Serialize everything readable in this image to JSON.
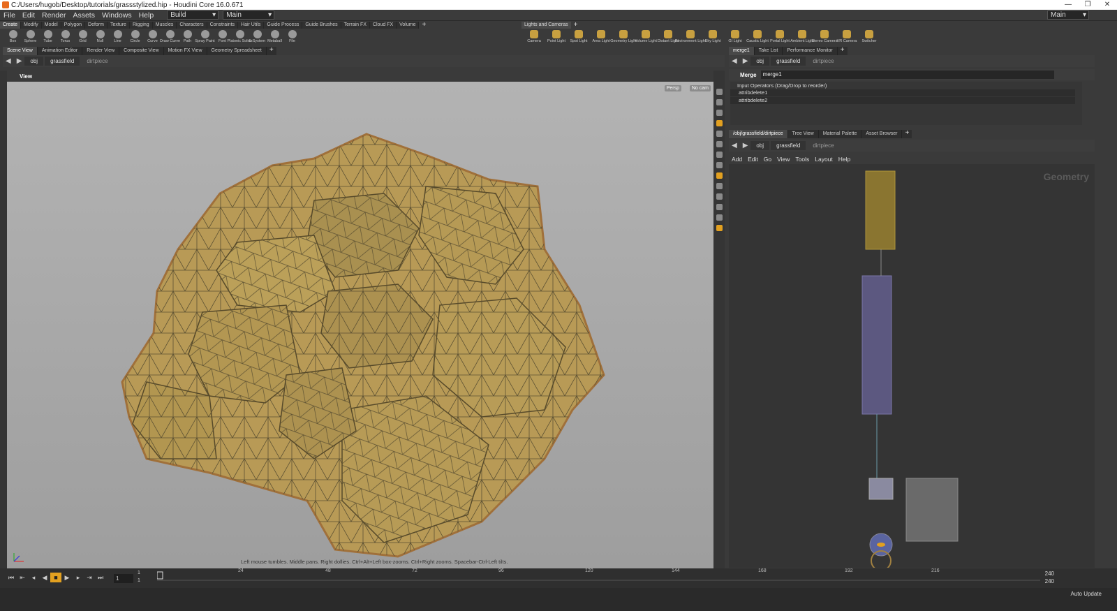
{
  "window": {
    "title": "C:/Users/hugob/Desktop/tutorials/grassstylized.hip - Houdini Core 16.0.671"
  },
  "menu": {
    "items": [
      "File",
      "Edit",
      "Render",
      "Assets",
      "Windows",
      "Help"
    ],
    "desktop": "Build",
    "desktop2": "Main",
    "right_desktop": "Main"
  },
  "shelf_tabs": [
    "Create",
    "Modify",
    "Model",
    "Polygon",
    "Deform",
    "Texture",
    "Rigging",
    "Muscles",
    "Characters",
    "Constraints",
    "Hair Utils",
    "Guide Process",
    "Guide Brushes",
    "Terrain FX",
    "Cloud FX",
    "Volume"
  ],
  "shelf_tools": [
    "Box",
    "Sphere",
    "Tube",
    "Torus",
    "Grid",
    "Null",
    "Line",
    "Circle",
    "Curve",
    "Draw Curve",
    "Path",
    "Spray Paint",
    "Font",
    "Platonic Solids",
    "L-System",
    "Metaball",
    "File"
  ],
  "shelf2_tab": "Lights and Cameras",
  "shelf2_tools": [
    "Camera",
    "Point Light",
    "Spot Light",
    "Area Light",
    "Geometry Light",
    "Volume Light",
    "Distant Light",
    "Environment Light",
    "Sky Light",
    "GI Light",
    "Caustic Light",
    "Portal Light",
    "Ambient Light",
    "Stereo Camera",
    "VR Camera",
    "Switcher"
  ],
  "left_tabs": [
    "Scene View",
    "Animation Editor",
    "Render View",
    "Composite View",
    "Motion FX View",
    "Geometry Spreadsheet"
  ],
  "right_top_tabs": [
    "merge1",
    "Take List",
    "Performance Monitor"
  ],
  "right_bottom_tabs": [
    "/obj/grassfield/dirtpiece",
    "Tree View",
    "Material Palette",
    "Asset Browser"
  ],
  "path": {
    "root": "obj",
    "obj": "grassfield",
    "node": "dirtpiece"
  },
  "viewport": {
    "title": "View",
    "persp": "Persp",
    "cam": "No cam",
    "hint": "Left mouse tumbles. Middle pans. Right dollies. Ctrl+Alt+Left box-zooms. Ctrl+Right zooms. Spacebar-Ctrl-Left tilts."
  },
  "params": {
    "type": "Merge",
    "name": "merge1",
    "header": "Input Operators (Drag/Drop to reorder)",
    "inputs": [
      "attribdelete1",
      "attribdelete2"
    ]
  },
  "network": {
    "menu": [
      "Add",
      "Edit",
      "Go",
      "View",
      "Tools",
      "Layout",
      "Help"
    ],
    "context": "Geometry"
  },
  "timeline": {
    "frame": "1",
    "start": "1",
    "end": "240",
    "end2": "240",
    "ticks": [
      "24",
      "48",
      "72",
      "96",
      "120",
      "144",
      "168",
      "192",
      "216"
    ],
    "auto_update": "Auto Update"
  },
  "colors": {
    "accent": "#e2a020",
    "mesh": "#b89a56",
    "wire": "#5b5032"
  }
}
